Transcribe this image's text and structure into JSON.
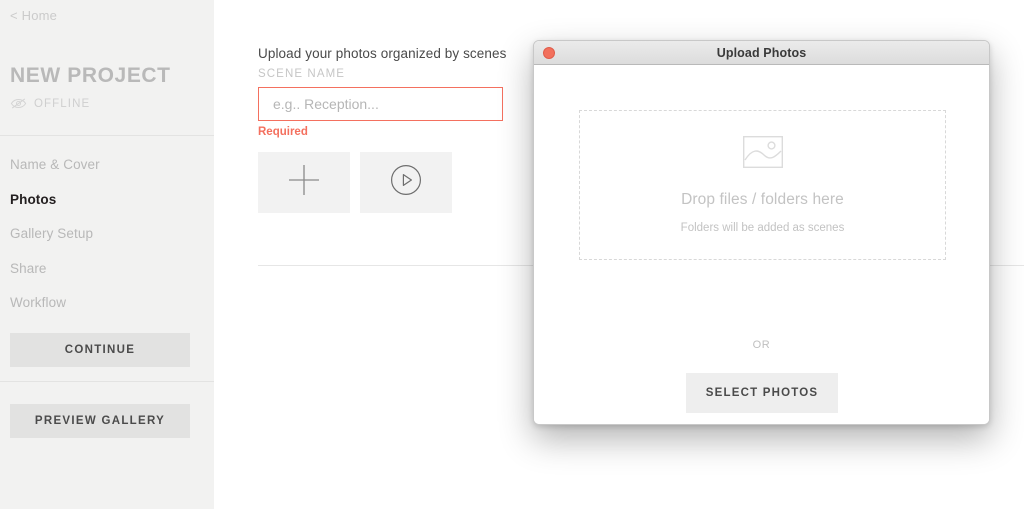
{
  "sidebar": {
    "home_link": "< Home",
    "project_title": "NEW PROJECT",
    "status_label": "OFFLINE",
    "status_icon": "eye-off-icon",
    "nav_items": [
      {
        "label": "Name & Cover",
        "active": false
      },
      {
        "label": "Photos",
        "active": true
      },
      {
        "label": "Gallery Setup",
        "active": false
      },
      {
        "label": "Share",
        "active": false
      },
      {
        "label": "Workflow",
        "active": false
      }
    ],
    "continue_label": "CONTINUE",
    "preview_label": "PREVIEW GALLERY"
  },
  "main": {
    "heading": "Upload your photos organized by scenes",
    "scene_field_label": "SCENE NAME",
    "scene_input_value": "",
    "scene_input_placeholder": "e.g.. Reception...",
    "required_message": "Required",
    "add_tile_icon": "plus-icon",
    "video_tile_icon": "play-circle-icon"
  },
  "modal": {
    "title": "Upload Photos",
    "close_icon": "close-dot-icon",
    "dropzone": {
      "icon": "image-placeholder-icon",
      "title": "Drop files / folders here",
      "subtitle": "Folders will be added as scenes"
    },
    "or_label": "OR",
    "select_photos_label": "SELECT PHOTOS"
  },
  "colors": {
    "accent_red": "#f4705f",
    "sidebar_bg": "#f2f2f1",
    "close_dot": "#f2705c",
    "text_dark": "#231f20",
    "text_muted": "#b8b8b8"
  }
}
